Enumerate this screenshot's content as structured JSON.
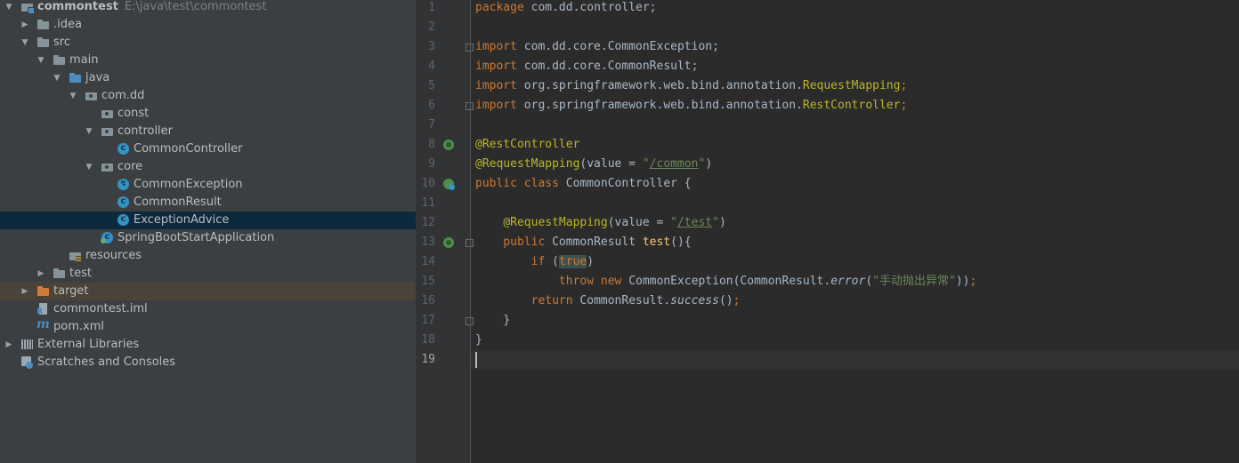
{
  "project_tree": {
    "rows": [
      {
        "label": "commontest",
        "path_hint": "E:\\java\\test\\commontest"
      },
      {
        "label": ".idea"
      },
      {
        "label": "src"
      },
      {
        "label": "main"
      },
      {
        "label": "java"
      },
      {
        "label": "com.dd"
      },
      {
        "label": "const"
      },
      {
        "label": "controller"
      },
      {
        "label": "CommonController"
      },
      {
        "label": "core"
      },
      {
        "label": "CommonException"
      },
      {
        "label": "CommonResult"
      },
      {
        "label": "ExceptionAdvice"
      },
      {
        "label": "SpringBootStartApplication"
      },
      {
        "label": "resources"
      },
      {
        "label": "test"
      },
      {
        "label": "target"
      },
      {
        "label": "commontest.iml"
      },
      {
        "label": "pom.xml"
      },
      {
        "label": "External Libraries"
      },
      {
        "label": "Scratches and Consoles"
      }
    ]
  },
  "editor": {
    "file": "CommonController.java",
    "current_line": 19,
    "line_numbers": [
      "1",
      "2",
      "3",
      "4",
      "5",
      "6",
      "7",
      "8",
      "9",
      "10",
      "11",
      "12",
      "13",
      "14",
      "15",
      "16",
      "17",
      "18",
      "19"
    ],
    "code": {
      "l1_kw": "package",
      "l1_rest": " com.dd.controller;",
      "l3_kw": "import",
      "l3_rest": " com.dd.core.CommonException;",
      "l4_kw": "import",
      "l4_rest": " com.dd.core.CommonResult;",
      "l5_kw": "import",
      "l5_pkg": " org.springframework.web.bind.annotation.",
      "l5_cls": "RequestMapping",
      "l5_end": ";",
      "l6_kw": "import",
      "l6_pkg": " org.springframework.web.bind.annotation.",
      "l6_cls": "RestController",
      "l6_end": ";",
      "l8_ann": "@RestController",
      "l9_ann": "@RequestMapping",
      "l9_mid": "(value = ",
      "l9_q1": "\"",
      "l9_str": "/common",
      "l9_q2": "\"",
      "l9_end": ")",
      "l10_kw": "public class",
      "l10_rest": " CommonController {",
      "l12_ann": "@RequestMapping",
      "l12_mid": "(value = ",
      "l12_q1": "\"",
      "l12_str": "/test",
      "l12_q2": "\"",
      "l12_end": ")",
      "l13_kw": "public",
      "l13_type": " CommonResult ",
      "l13_fn": "test",
      "l13_end": "(){",
      "l14_kw": "if",
      "l14_open": " (",
      "l14_true": "true",
      "l14_close": ")",
      "l15_kw": "throw new",
      "l15_mid": " CommonException(CommonResult.",
      "l15_it": "error",
      "l15_open": "(",
      "l15_str": "\"手动抛出异常\"",
      "l15_close": "))",
      "l15_end": ";",
      "l16_kw": "return",
      "l16_mid": " CommonResult.",
      "l16_it": "success",
      "l16_paren": "()",
      "l16_end": ";",
      "l17": "}",
      "l18": "}"
    }
  }
}
